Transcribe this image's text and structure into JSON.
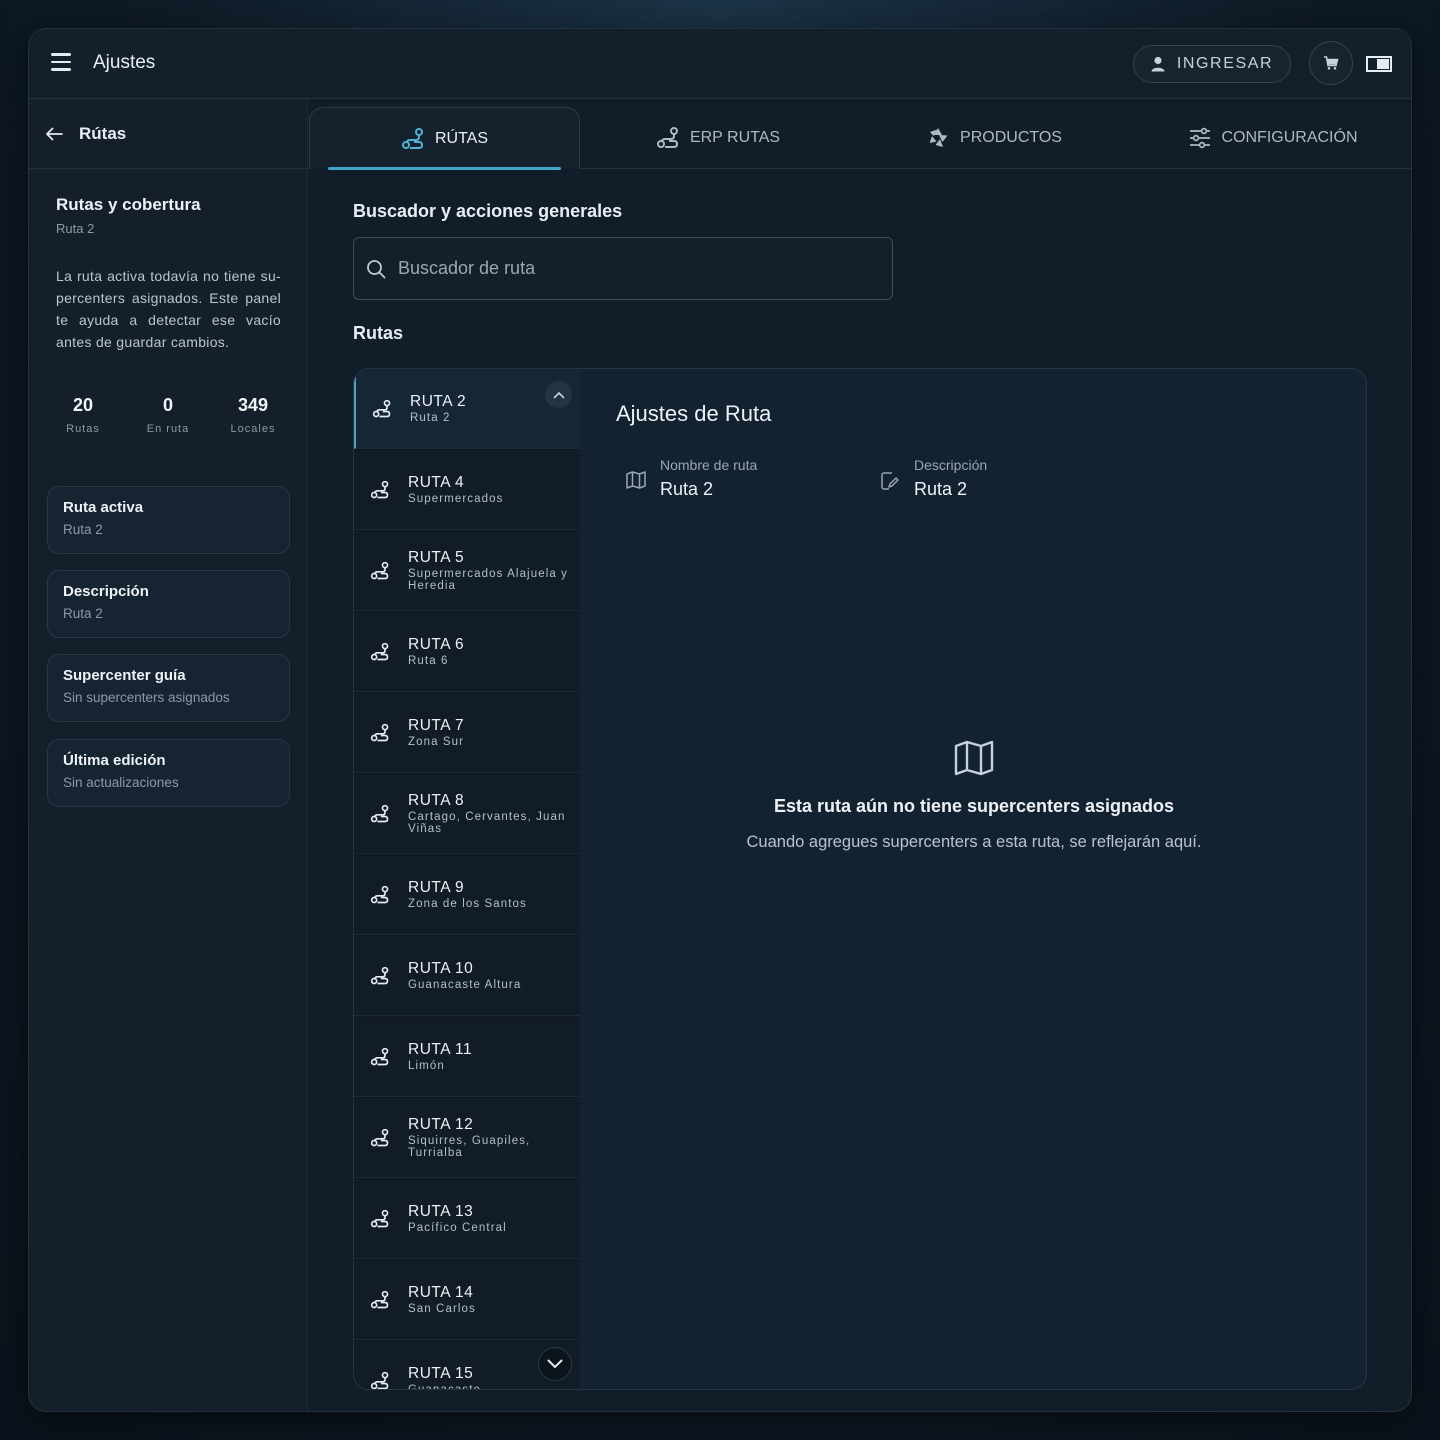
{
  "app": {
    "title": "Ajustes"
  },
  "header": {
    "login_label": "INGRESAR"
  },
  "sidebar": {
    "back_label": "Rútas",
    "title": "Rutas y cobertura",
    "subtitle": "Ruta 2",
    "description": "La ruta activa todavía no tiene su-percenters asignados. Este panel te ayuda a detectar ese vacío antes de guardar cambios.",
    "stats": [
      {
        "value": "20",
        "label": "Rutas"
      },
      {
        "value": "0",
        "label": "En ruta"
      },
      {
        "value": "349",
        "label": "Locales"
      }
    ],
    "cards": [
      {
        "title": "Ruta activa",
        "value": "Ruta 2"
      },
      {
        "title": "Descripción",
        "value": "Ruta 2"
      },
      {
        "title": "Supercenter guía",
        "value": "Sin supercenters asignados"
      },
      {
        "title": "Última edición",
        "value": "Sin actualizaciones"
      }
    ]
  },
  "tabs": [
    {
      "label": "RÚTAS",
      "icon": "route-icon",
      "active": true
    },
    {
      "label": "ERP RUTAS",
      "icon": "route-icon",
      "active": false
    },
    {
      "label": "PRODUCTOS",
      "icon": "aperture-icon",
      "active": false
    },
    {
      "label": "CONFIGURACIÓN",
      "icon": "sliders-icon",
      "active": false
    }
  ],
  "search": {
    "section_title": "Buscador y acciones generales",
    "placeholder": "Buscador de ruta"
  },
  "routes": {
    "section_title": "Rutas",
    "items": [
      {
        "name": "RUTA 2",
        "sub": "Ruta 2"
      },
      {
        "name": "RUTA 4",
        "sub": "Supermercados"
      },
      {
        "name": "RUTA 5",
        "sub": "Supermercados Alajuela y Heredia"
      },
      {
        "name": "RUTA 6",
        "sub": "Ruta 6"
      },
      {
        "name": "RUTA 7",
        "sub": "Zona Sur"
      },
      {
        "name": "RUTA 8",
        "sub": "Cartago, Cervantes, Juan Viñas"
      },
      {
        "name": "RUTA 9",
        "sub": "Zona de los Santos"
      },
      {
        "name": "RUTA 10",
        "sub": "Guanacaste Altura"
      },
      {
        "name": "RUTA 11",
        "sub": "Limón"
      },
      {
        "name": "RUTA 12",
        "sub": "Siquirres, Guapiles, Turrialba"
      },
      {
        "name": "RUTA 13",
        "sub": "Pacífico Central"
      },
      {
        "name": "RUTA 14",
        "sub": "San Carlos"
      },
      {
        "name": "RUTA 15",
        "sub": "Guanacaste"
      }
    ]
  },
  "detail": {
    "title": "Ajustes de Ruta",
    "fields": [
      {
        "label": "Nombre de ruta",
        "value": "Ruta 2",
        "icon": "map-icon"
      },
      {
        "label": "Descripción",
        "value": "Ruta 2",
        "icon": "edit-icon"
      }
    ],
    "empty_title": "Esta ruta aún no tiene supercenters asignados",
    "empty_text": "Cuando agregues supercenters a esta ruta, se reflejarán aquí."
  },
  "colors": {
    "accent": "#3fa6c8",
    "background": "#111d29"
  }
}
